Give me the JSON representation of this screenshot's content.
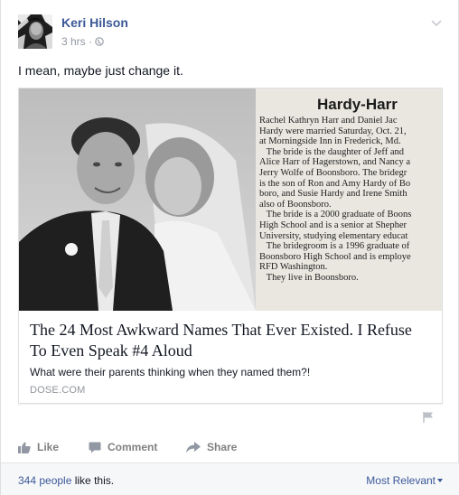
{
  "post": {
    "author": "Keri Hilson",
    "time": "3 hrs",
    "separator": "·",
    "status_text": "I mean, maybe just change it."
  },
  "link": {
    "clipping_heading": "Hardy-Harr",
    "clipping_text": "Rachel Kathryn Harr and Daniel Jac\nHardy were married Saturday, Oct. 21,\nat Morningside Inn in Frederick, Md.\n   The bride is the daughter of Jeff and\nAlice Harr of Hagerstown, and Nancy a\nJerry Wolfe of Boonsboro. The bridegr\nis the son of Ron and Amy Hardy of Bo\nboro, and Susie Hardy and Irene Smith\nalso of Boonsboro.\n   The bride is a 2000 graduate of Boons\nHigh School and is a senior at Shepher\nUniversity, studying elementary educat\n   The bridegroom is a 1996 graduate of\nBoonsboro High School and is employe\nRFD Washington.\n   They live in Boonsboro.",
    "title": "The 24 Most Awkward Names That Ever Existed. I Refuse To Even Speak #4 Aloud",
    "description": "What were their parents thinking when they named them?!",
    "domain": "DOSE.COM"
  },
  "actions": {
    "like": "Like",
    "comment": "Comment",
    "share": "Share"
  },
  "footer": {
    "likes_count": "344 people",
    "likes_suffix": " like this.",
    "sort": "Most Relevant"
  },
  "colors": {
    "link_blue": "#3b5998",
    "meta_gray": "#9197a3",
    "action_gray": "#7f7f7f",
    "footer_bg": "#f6f7f9"
  },
  "icons": [
    "globe-icon",
    "chevron-down-icon",
    "like-icon",
    "comment-icon",
    "share-icon",
    "flag-icon"
  ]
}
